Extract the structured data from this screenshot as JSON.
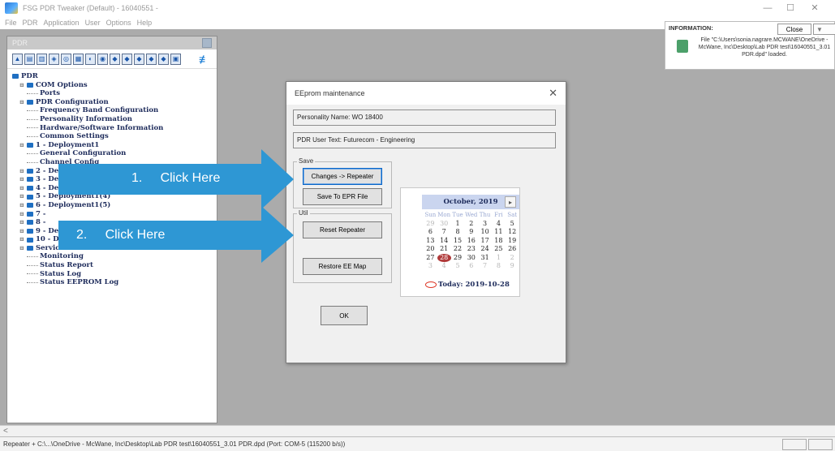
{
  "window": {
    "title": "FSG PDR Tweaker (Default) - 16040551 -",
    "minimize": "—",
    "maximize": "☐",
    "close": "✕"
  },
  "menu": [
    "File",
    "PDR",
    "Application",
    "User",
    "Options",
    "Help"
  ],
  "tree_panel": {
    "caption": "PDR",
    "nodes": [
      {
        "label": "PDR",
        "level": 0,
        "type": "folder"
      },
      {
        "label": "COM Options",
        "level": 1,
        "type": "folder"
      },
      {
        "label": "Ports",
        "level": 2,
        "type": "leaf"
      },
      {
        "label": "PDR Configuration",
        "level": 1,
        "type": "folder"
      },
      {
        "label": "Frequency Band Configuration",
        "level": 2,
        "type": "leaf"
      },
      {
        "label": "Personality Information",
        "level": 2,
        "type": "leaf"
      },
      {
        "label": "Hardware/Software Information",
        "level": 2,
        "type": "leaf"
      },
      {
        "label": "Common Settings",
        "level": 2,
        "type": "leaf"
      },
      {
        "label": "1 - Deployment1",
        "level": 1,
        "type": "folder"
      },
      {
        "label": "General Configuration",
        "level": 2,
        "type": "leaf"
      },
      {
        "label": "Channel Config",
        "level": 2,
        "type": "leaf"
      },
      {
        "label": "2 - Deployment1(",
        "level": 1,
        "type": "folder"
      },
      {
        "label": "3 - Deployment1(",
        "level": 1,
        "type": "folder"
      },
      {
        "label": "4 - Deployment1(3)",
        "level": 1,
        "type": "folder"
      },
      {
        "label": "5 - Deployment1(4)",
        "level": 1,
        "type": "folder"
      },
      {
        "label": "6 - Deployment1(5)",
        "level": 1,
        "type": "folder"
      },
      {
        "label": "7 -",
        "level": 1,
        "type": "folder"
      },
      {
        "label": "8 -",
        "level": 1,
        "type": "folder"
      },
      {
        "label": "9 - Deployment1(8)",
        "level": 1,
        "type": "folder"
      },
      {
        "label": "10 - Deployment1(9)",
        "level": 1,
        "type": "folder"
      },
      {
        "label": "Service",
        "level": 1,
        "type": "folder"
      },
      {
        "label": "Monitoring",
        "level": 2,
        "type": "leaf"
      },
      {
        "label": "Status Report",
        "level": 2,
        "type": "leaf"
      },
      {
        "label": "Status Log",
        "level": 2,
        "type": "leaf"
      },
      {
        "label": "Status EEPROM Log",
        "level": 2,
        "type": "leaf"
      }
    ]
  },
  "dialog": {
    "title": "EEprom maintenance",
    "close": "✕",
    "personality_name": "Personality Name: WO 18400",
    "user_text": "PDR User Text: Futurecom - Engineering",
    "save_group_label": "Save",
    "changes_button": "Changes -> Repeater",
    "save_epr_button": "Save To EPR File",
    "util_group_label": "Util",
    "reset_button": "Reset Repeater",
    "restore_button": "Restore EE Map",
    "ok_button": "OK"
  },
  "calendar": {
    "month_label": "October, 2019",
    "prev": "◂",
    "next": "▸",
    "weekdays": [
      "Sun",
      "Mon",
      "Tue",
      "Wed",
      "Thu",
      "Fri",
      "Sat"
    ],
    "weeks": [
      [
        {
          "d": "29",
          "o": true
        },
        {
          "d": "30",
          "o": true
        },
        {
          "d": "1"
        },
        {
          "d": "2"
        },
        {
          "d": "3"
        },
        {
          "d": "4"
        },
        {
          "d": "5"
        }
      ],
      [
        {
          "d": "6"
        },
        {
          "d": "7"
        },
        {
          "d": "8"
        },
        {
          "d": "9"
        },
        {
          "d": "10"
        },
        {
          "d": "11"
        },
        {
          "d": "12"
        }
      ],
      [
        {
          "d": "13"
        },
        {
          "d": "14"
        },
        {
          "d": "15"
        },
        {
          "d": "16"
        },
        {
          "d": "17"
        },
        {
          "d": "18"
        },
        {
          "d": "19"
        }
      ],
      [
        {
          "d": "20"
        },
        {
          "d": "21"
        },
        {
          "d": "22"
        },
        {
          "d": "23"
        },
        {
          "d": "24"
        },
        {
          "d": "25"
        },
        {
          "d": "26"
        }
      ],
      [
        {
          "d": "27"
        },
        {
          "d": "28",
          "s": true
        },
        {
          "d": "29"
        },
        {
          "d": "30"
        },
        {
          "d": "31"
        },
        {
          "d": "1",
          "o": true
        },
        {
          "d": "2",
          "o": true
        }
      ],
      [
        {
          "d": "3",
          "o": true
        },
        {
          "d": "4",
          "o": true
        },
        {
          "d": "5",
          "o": true
        },
        {
          "d": "6",
          "o": true
        },
        {
          "d": "7",
          "o": true
        },
        {
          "d": "8",
          "o": true
        },
        {
          "d": "9",
          "o": true
        }
      ]
    ],
    "today_label": "Today: 2019-10-28"
  },
  "info_balloon": {
    "title": "INFORMATION:",
    "close_button": "Close",
    "more_button": "▼",
    "message": "File \"C:\\Users\\sonia.nagrare.MCWANE\\OneDrive - McWane, Inc\\Desktop\\Lab PDR test\\16040551_3.01 PDR.dpd\" loaded."
  },
  "annotations": {
    "step1": "1.     Click Here",
    "step2": "2.     Click Here",
    "arrow_color": "#2e97d4"
  },
  "status_bar": {
    "scroll_left": "<",
    "text": "Repeater + C:\\...\\OneDrive - McWane, Inc\\Desktop\\Lab PDR test\\16040551_3.01 PDR.dpd  (Port: COM-5  (115200 b/s))"
  }
}
